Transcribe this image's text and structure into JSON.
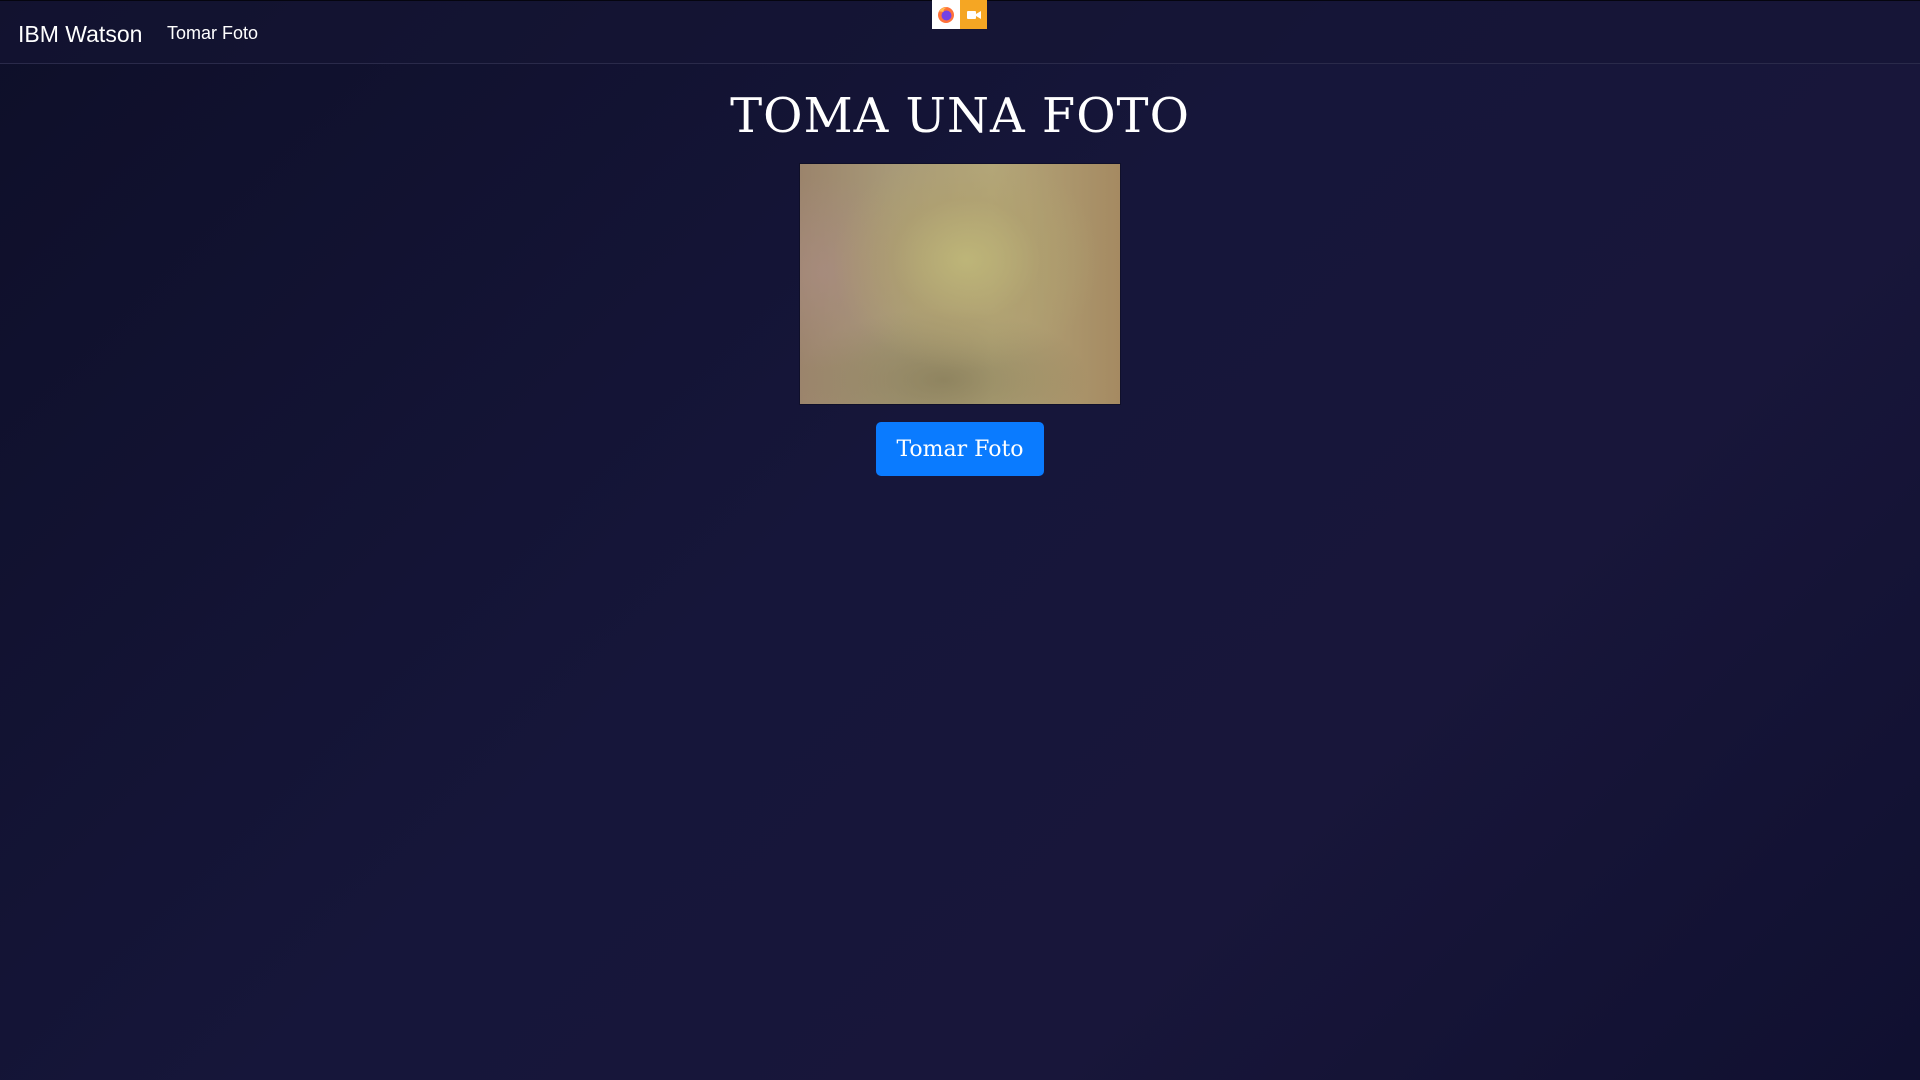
{
  "navbar": {
    "brand": "IBM Watson",
    "link": "Tomar Foto"
  },
  "indicator": {
    "browser_icon": "firefox-icon",
    "camera_icon": "video-camera-icon",
    "camera_color": "#f5a623"
  },
  "main": {
    "title": "TOMA UNA FOTO",
    "video": "webcam-preview",
    "button_label": "Tomar Foto",
    "button_color": "#0a7bff"
  },
  "colors": {
    "background": "#16163a",
    "text": "#ffffff"
  }
}
